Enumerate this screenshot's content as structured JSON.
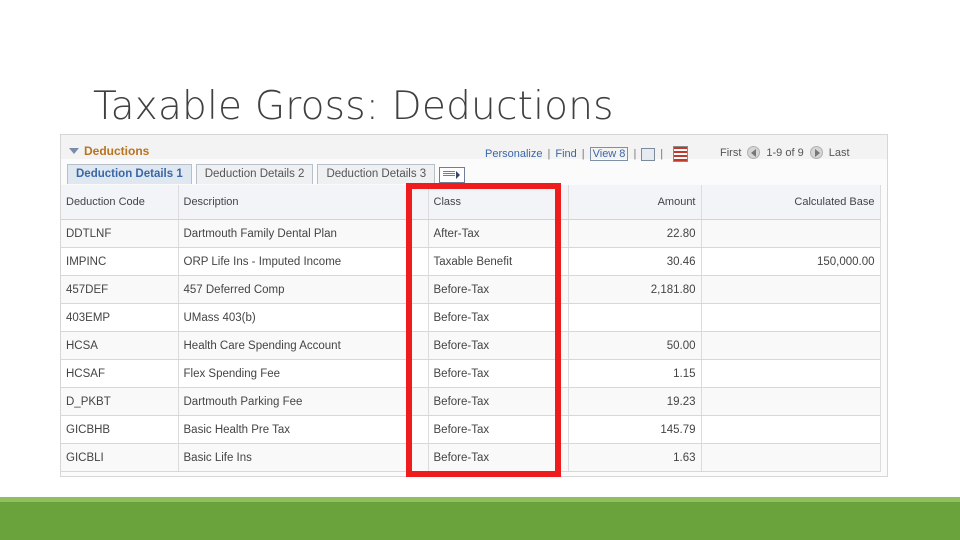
{
  "slide": {
    "title": "Taxable Gross: Deductions"
  },
  "grid": {
    "title": "Deductions",
    "tools": {
      "personalize": "Personalize",
      "find": "Find",
      "view": "View 8"
    },
    "nav": {
      "first": "First",
      "range": "1-9 of 9",
      "last": "Last"
    },
    "tabs": [
      "Deduction Details 1",
      "Deduction Details 2",
      "Deduction Details 3"
    ],
    "columns": {
      "code": "Deduction Code",
      "description": "Description",
      "class": "Class",
      "amount": "Amount",
      "calc_base": "Calculated Base"
    },
    "rows": [
      {
        "code": "DDTLNF",
        "description": "Dartmouth Family Dental Plan",
        "class": "After-Tax",
        "amount": "22.80",
        "calc_base": ""
      },
      {
        "code": "IMPINC",
        "description": "ORP Life Ins - Imputed Income",
        "class": "Taxable Benefit",
        "amount": "30.46",
        "calc_base": "150,000.00"
      },
      {
        "code": "457DEF",
        "description": "457 Deferred Comp",
        "class": "Before-Tax",
        "amount": "2,181.80",
        "calc_base": ""
      },
      {
        "code": "403EMP",
        "description": "UMass 403(b)",
        "class": "Before-Tax",
        "amount": "",
        "calc_base": ""
      },
      {
        "code": "HCSA",
        "description": "Health Care Spending Account",
        "class": "Before-Tax",
        "amount": "50.00",
        "calc_base": ""
      },
      {
        "code": "HCSAF",
        "description": "Flex Spending Fee",
        "class": "Before-Tax",
        "amount": "1.15",
        "calc_base": ""
      },
      {
        "code": "D_PKBT",
        "description": "Dartmouth Parking Fee",
        "class": "Before-Tax",
        "amount": "19.23",
        "calc_base": ""
      },
      {
        "code": "GICBHB",
        "description": "Basic Health Pre Tax",
        "class": "Before-Tax",
        "amount": "145.79",
        "calc_base": ""
      },
      {
        "code": "GICBLI",
        "description": "Basic Life Ins",
        "class": "Before-Tax",
        "amount": "1.63",
        "calc_base": ""
      }
    ]
  },
  "annotation": {
    "color": "#ee1c1c",
    "highlighted_column": "Class"
  },
  "theme": {
    "accent_green": "#6aa23b",
    "link_blue": "#3a67a6",
    "grid_title_orange": "#b8741f"
  }
}
